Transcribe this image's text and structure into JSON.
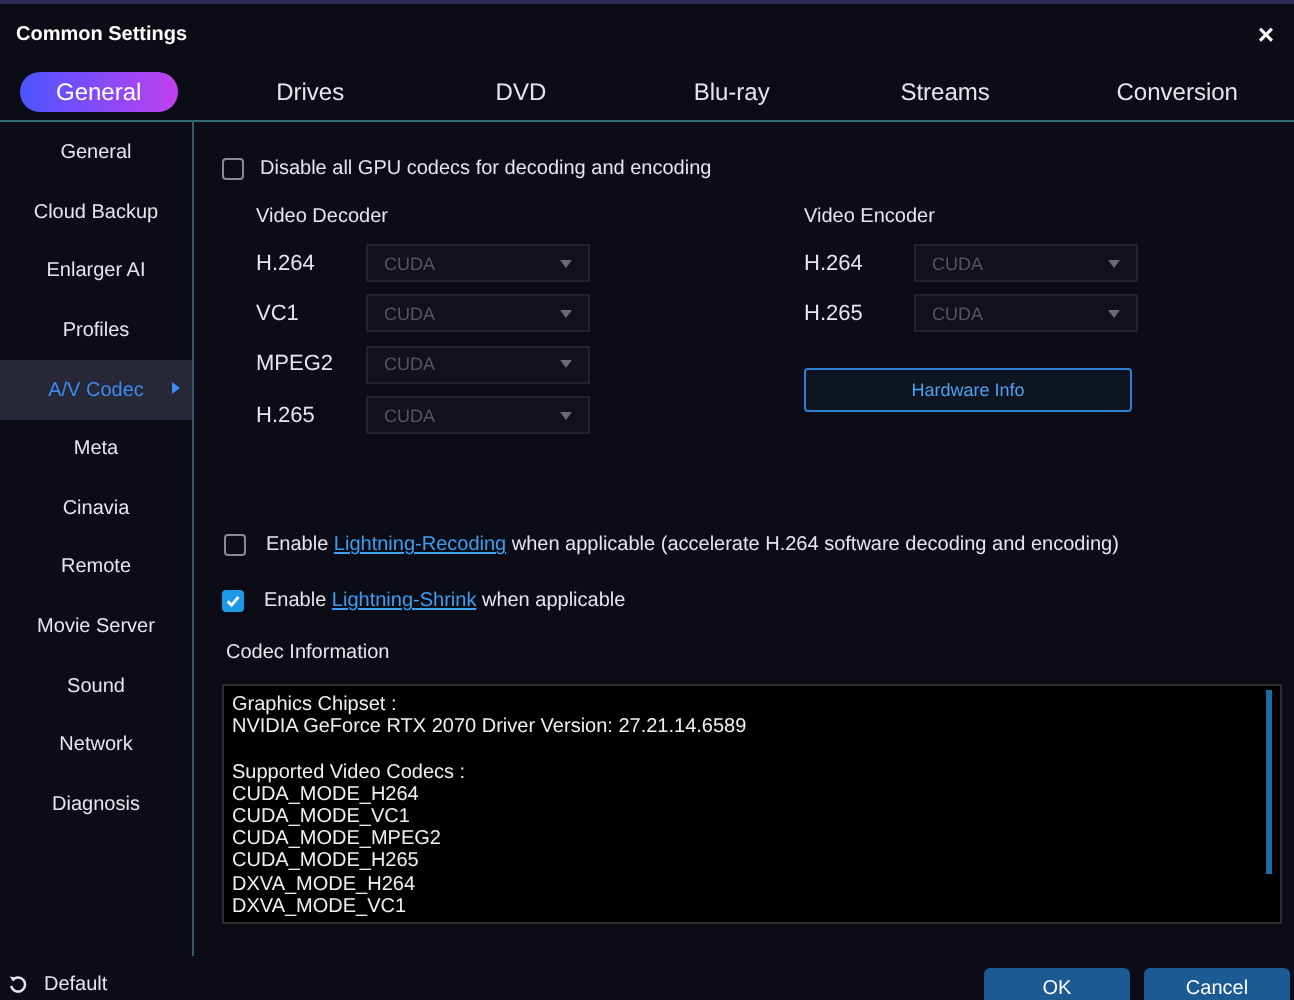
{
  "window": {
    "title": "Common Settings",
    "close": "×"
  },
  "tabs": [
    {
      "label": "General",
      "selected": true
    },
    {
      "label": "Drives",
      "selected": false
    },
    {
      "label": "DVD",
      "selected": false
    },
    {
      "label": "Blu-ray",
      "selected": false
    },
    {
      "label": "Streams",
      "selected": false
    },
    {
      "label": "Conversion",
      "selected": false
    }
  ],
  "sidebar": {
    "items": [
      {
        "label": "General",
        "selected": false
      },
      {
        "label": "Cloud Backup",
        "selected": false
      },
      {
        "label": "Enlarger AI",
        "selected": false
      },
      {
        "label": "Profiles",
        "selected": false
      },
      {
        "label": "A/V Codec",
        "selected": true
      },
      {
        "label": "Meta",
        "selected": false
      },
      {
        "label": "Cinavia",
        "selected": false
      },
      {
        "label": "Remote",
        "selected": false
      },
      {
        "label": "Movie Server",
        "selected": false
      },
      {
        "label": "Sound",
        "selected": false
      },
      {
        "label": "Network",
        "selected": false
      },
      {
        "label": "Diagnosis",
        "selected": false
      }
    ]
  },
  "disable_gpu": {
    "label": "Disable all GPU codecs for decoding and encoding",
    "checked": false
  },
  "video_decoder": {
    "title": "Video Decoder",
    "rows": [
      {
        "label": "H.264",
        "value": "CUDA",
        "disabled": true
      },
      {
        "label": "VC1",
        "value": "CUDA",
        "disabled": true
      },
      {
        "label": "MPEG2",
        "value": "CUDA",
        "disabled": true
      },
      {
        "label": "H.265",
        "value": "CUDA",
        "disabled": true
      }
    ]
  },
  "video_encoder": {
    "title": "Video Encoder",
    "rows": [
      {
        "label": "H.264",
        "value": "CUDA",
        "disabled": true
      },
      {
        "label": "H.265",
        "value": "CUDA",
        "disabled": true
      }
    ]
  },
  "hardware_info_button": "Hardware Info",
  "options": [
    {
      "before": "Enable",
      "link": "Lightning-Recoding",
      "after": "when applicable (accelerate H.264 software decoding and encoding)",
      "checked": false
    },
    {
      "before": "Enable",
      "link": "Lightning-Shrink",
      "after": "when applicable",
      "checked": true
    }
  ],
  "codec_information": {
    "title": "Codec Information",
    "sections": [
      {
        "lines": [
          "Graphics Chipset :",
          "NVIDIA GeForce RTX 2070 Driver Version: 27.21.14.6589"
        ]
      },
      {
        "lines": [
          "Supported Video Codecs :",
          "CUDA_MODE_H264",
          "CUDA_MODE_VC1",
          "CUDA_MODE_MPEG2",
          "CUDA_MODE_H265",
          "DXVA_MODE_H264",
          "DXVA_MODE_VC1"
        ]
      }
    ]
  },
  "footer": {
    "default": "Default",
    "buttons": [
      "OK",
      "Cancel"
    ]
  }
}
